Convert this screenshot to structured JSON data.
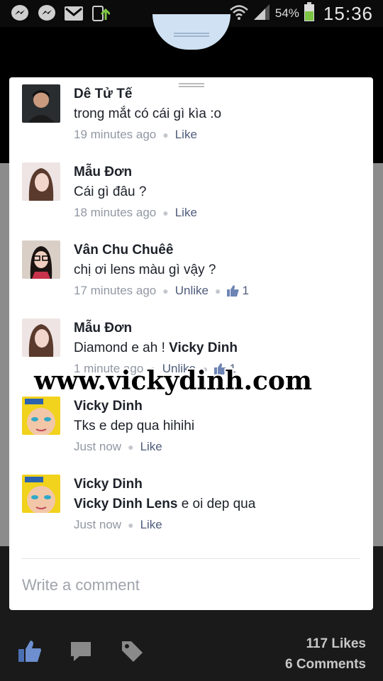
{
  "statusbar": {
    "icons": [
      "messenger-icon",
      "messenger-icon",
      "gmail-icon",
      "download-icon"
    ],
    "battery_percent": "54%",
    "time": "15:36"
  },
  "comments": [
    {
      "name": "Dê Tử Tế",
      "text": "trong mắt có cái gì kìa :o",
      "mention": "",
      "time": "19 minutes ago",
      "action": "Like",
      "likes": ""
    },
    {
      "name": "Mẫu Đơn",
      "text": "Cái gì đâu ?",
      "mention": "",
      "time": "18 minutes ago",
      "action": "Like",
      "likes": ""
    },
    {
      "name": "Vân Chu Chuêê",
      "text": "chị ơi lens màu gì vậy ?",
      "mention": "",
      "time": "17 minutes ago",
      "action": "Unlike",
      "likes": "1"
    },
    {
      "name": "Mẫu Đơn",
      "text": "Diamond e ah ! ",
      "mention": "Vicky Dinh",
      "time": "1 minute ago",
      "action": "Unlike",
      "likes": "1"
    },
    {
      "name": "Vicky Dinh",
      "text": "Tks e dep qua hihihi",
      "mention": "",
      "time": "Just now",
      "action": "Like",
      "likes": ""
    },
    {
      "name": "Vicky Dinh",
      "mention_lead": "Vicky Dinh Lens",
      "text": " e oi dep qua",
      "time": "Just now",
      "action": "Like",
      "likes": ""
    }
  ],
  "composer": {
    "placeholder": "Write a comment"
  },
  "watermark": "www.vickydinh.com",
  "footer": {
    "likes": "117 Likes",
    "comments": "6 Comments"
  },
  "colors": {
    "name": "#1d2129",
    "meta": "#9197a3",
    "link": "#4e5b7a",
    "sheet": "#ffffff"
  }
}
